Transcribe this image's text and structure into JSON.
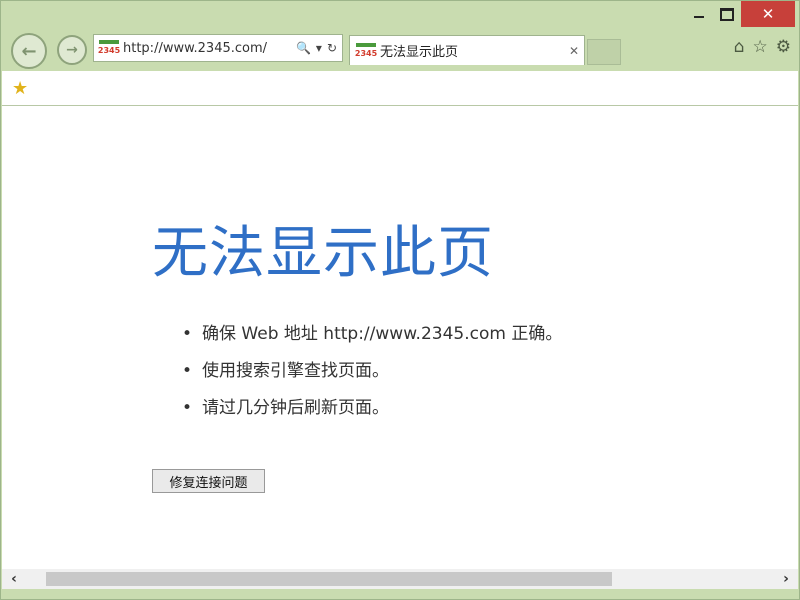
{
  "window": {
    "min_label": "",
    "max_label": "",
    "close_label": "✕"
  },
  "nav": {
    "back_label": "←",
    "forward_label": "→",
    "address": {
      "url": "http://www.2345.com/",
      "site_icon_text": "2345",
      "search_icon": "🔍",
      "dropdown_icon": "▾",
      "refresh_icon": "↻"
    },
    "tab": {
      "title": "无法显示此页",
      "close": "✕"
    },
    "right_icons": {
      "home": "⌂",
      "favorites": "☆",
      "settings": "⚙"
    }
  },
  "favorites_bar": {
    "star": "★"
  },
  "content": {
    "title": "无法显示此页",
    "bullets": [
      "确保 Web 地址 http://www.2345.com 正确。",
      "使用搜索引擎查找页面。",
      "请过几分钟后刷新页面。"
    ],
    "fix_button": "修复连接问题"
  },
  "scrollbar": {
    "left_arrow": "‹",
    "right_arrow": "›"
  }
}
